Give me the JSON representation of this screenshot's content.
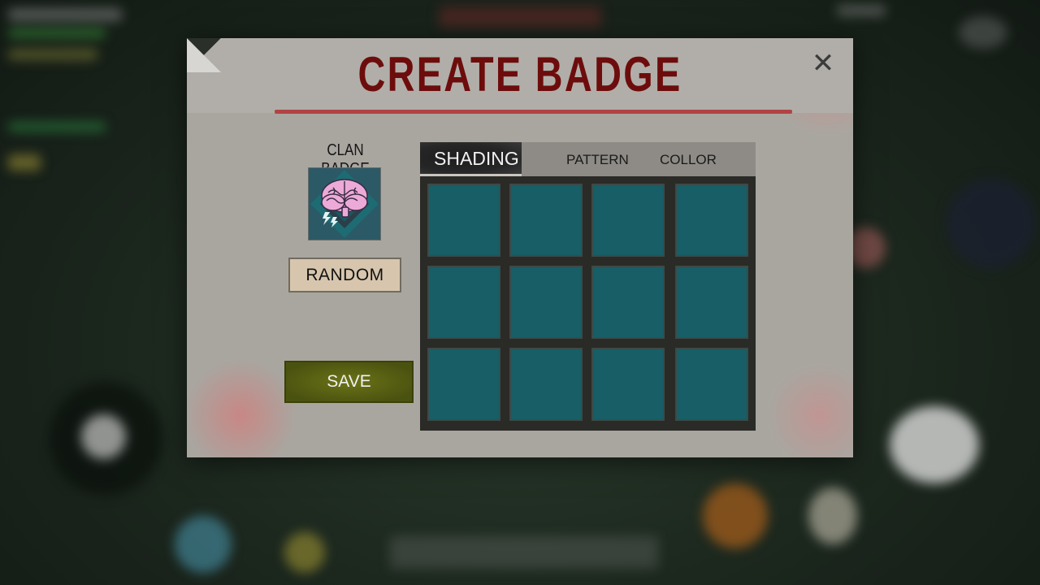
{
  "dialog": {
    "title": "CREATE BADGE",
    "close_glyph": "✕",
    "clan_badge_label": "CLAN BADGE",
    "badge_icon": "brain-lightning-icon",
    "random_label": "RANDOM",
    "save_label": "SAVE"
  },
  "tabs": [
    {
      "label": "SHADING",
      "active": true
    },
    {
      "label": "PATTERN",
      "active": false
    },
    {
      "label": "COLLOR",
      "active": false
    }
  ],
  "swatches": {
    "rows": 3,
    "columns": 4,
    "color": "#175e66"
  },
  "colors": {
    "title": "#6d0c0c",
    "panel": "#a9a6a0",
    "save_button": "#5a6214",
    "random_button": "#d7c6ad",
    "badge_background": "#2c5966",
    "brain": "#e9a9d6"
  }
}
